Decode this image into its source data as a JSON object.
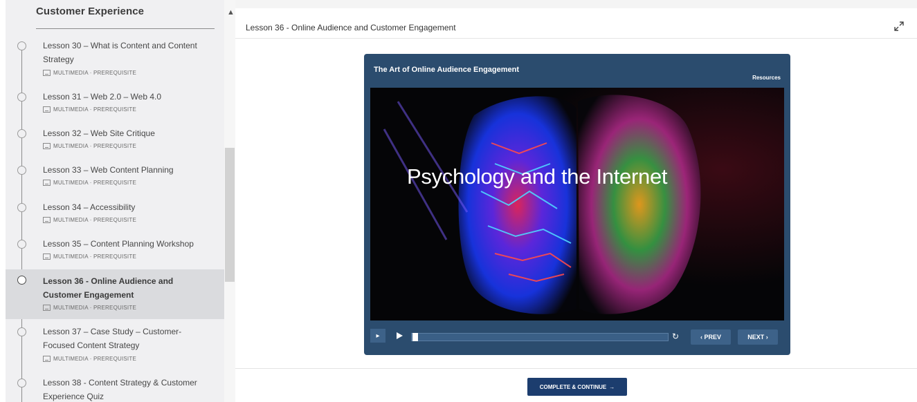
{
  "sidebar": {
    "section_title": "Customer Experience",
    "collapse_icon": "caret-up-icon",
    "lessons": [
      {
        "title": "Lesson 30 – What is Content and Content Strategy",
        "meta": "MULTIMEDIA · PREREQUISITE"
      },
      {
        "title": "Lesson 31 – Web 2.0 – Web 4.0",
        "meta": "MULTIMEDIA · PREREQUISITE"
      },
      {
        "title": "Lesson 32 – Web Site Critique",
        "meta": "MULTIMEDIA · PREREQUISITE"
      },
      {
        "title": "Lesson 33 – Web Content Planning",
        "meta": "MULTIMEDIA · PREREQUISITE"
      },
      {
        "title": "Lesson 34 – Accessibility",
        "meta": "MULTIMEDIA · PREREQUISITE"
      },
      {
        "title": "Lesson 35 – Content Planning Workshop",
        "meta": "MULTIMEDIA · PREREQUISITE"
      },
      {
        "title": "Lesson 36 - Online Audience and Customer Engagement",
        "meta": "MULTIMEDIA · PREREQUISITE",
        "active": true
      },
      {
        "title": "Lesson 37 – Case Study – Customer-Focused Content Strategy",
        "meta": "MULTIMEDIA · PREREQUISITE"
      },
      {
        "title": "Lesson 38 - Content Strategy & Customer Experience Quiz",
        "meta": ""
      }
    ]
  },
  "main": {
    "title": "Lesson 36 - Online Audience and Customer Engagement",
    "expand_icon": "expand-icon",
    "complete_label": "COMPLETE & CONTINUE",
    "complete_icon": "arrow-right-icon"
  },
  "player": {
    "title": "The Art of Online Audience Engagement",
    "resources_label": "Resources",
    "caption": "Psychology and the Internet",
    "prev_label": "PREV",
    "next_label": "NEXT",
    "progress": 0.0
  },
  "colors": {
    "accent": "#1c3d6e",
    "player_frame": "#2b4c6e",
    "player_button": "#3d6289"
  }
}
